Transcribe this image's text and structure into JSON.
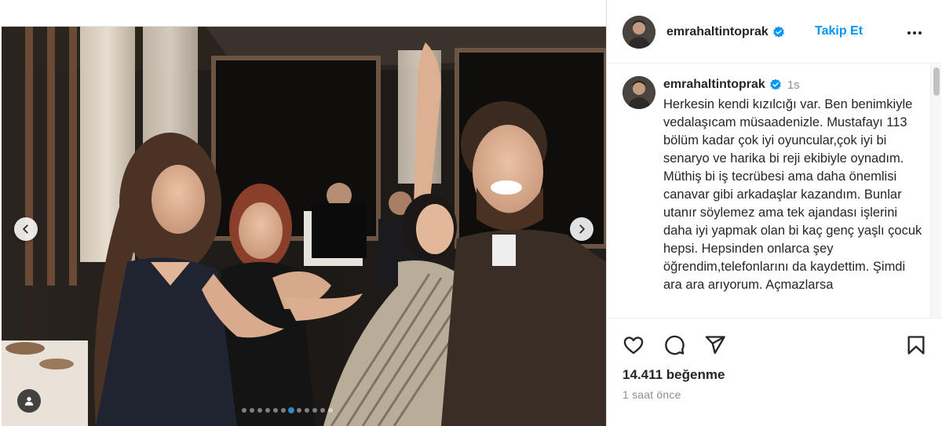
{
  "post": {
    "username": "emrahaltintoprak",
    "follow_label": "Takip Et",
    "caption_time": "1s",
    "caption": "Herkesin kendi kızılcığı var. Ben benimkiyle vedalaşıcam müsaadenizle. Mustafayı 113 bölüm kadar çok iyi oyuncular,çok iyi bi senaryo ve harika bi reji ekibiyle oynadım. Müthiş bi iş tecrübesi ama daha önemlisi canavar gibi arkadaşlar kazandım. Bunlar utanır söylemez ama tek ajandası işlerini daha iyi yapmak olan bi kaç genç yaşlı çocuk hepsi. Hepsinden onlarca şey öğrendim,telefonlarını da kaydettim. Şimdi ara ara arıyorum. Açmazlarsa",
    "likes": "14.411 beğenme",
    "time_ago": "1 saat önce"
  },
  "carousel": {
    "slide_count": 12,
    "active_index": 6
  },
  "icons": {
    "verified": "verified-badge-icon",
    "more": "more-options-icon",
    "like": "heart-icon",
    "comment": "comment-icon",
    "share": "share-icon",
    "save": "bookmark-icon",
    "prev": "chevron-left-icon",
    "next": "chevron-right-icon",
    "tag": "user-tag-icon"
  },
  "colors": {
    "link_blue": "#0095f6",
    "text": "#262626",
    "muted": "#8e8e8e"
  }
}
